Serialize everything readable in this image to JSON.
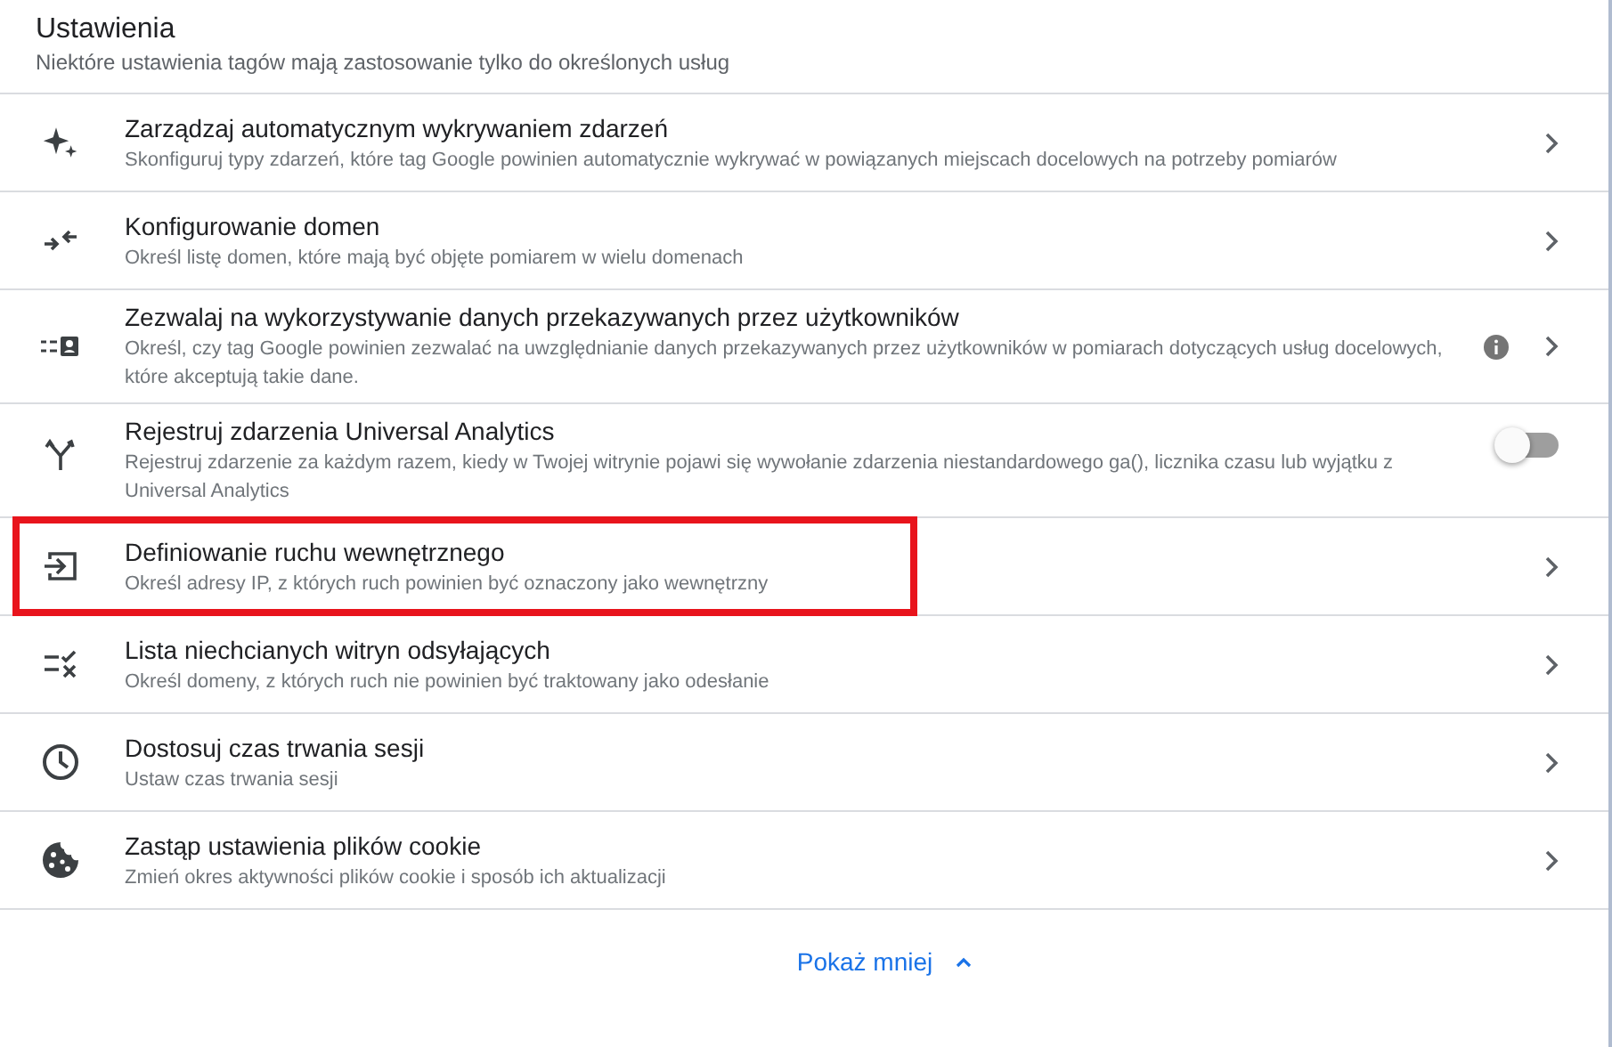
{
  "header": {
    "title": "Ustawienia",
    "subtitle": "Niektóre ustawienia tagów mają zastosowanie tylko do określonych usług"
  },
  "settings": [
    {
      "title": "Zarządzaj automatycznym wykrywaniem zdarzeń",
      "description": "Skonfiguruj typy zdarzeń, które tag Google powinien automatycznie wykrywać w powiązanych miejscach docelowych na potrzeby pomiarów",
      "kind": "link",
      "highlighted": false
    },
    {
      "title": "Konfigurowanie domen",
      "description": "Określ listę domen, które mają być objęte pomiarem w wielu domenach",
      "kind": "link",
      "highlighted": false
    },
    {
      "title": "Zezwalaj na wykorzystywanie danych przekazywanych przez użytkowników",
      "description": "Określ, czy tag Google powinien zezwalać na uwzględnianie danych przekazywanych przez użytkowników w pomiarach dotyczących usług docelowych, które akceptują takie dane.",
      "kind": "info_link",
      "highlighted": false
    },
    {
      "title": "Rejestruj zdarzenia Universal Analytics",
      "description": "Rejestruj zdarzenie za każdym razem, kiedy w Twojej witrynie pojawi się wywołanie zdarzenia niestandardowego ga(), licznika czasu lub wyjątku z Universal Analytics",
      "kind": "toggle",
      "on": false,
      "highlighted": false
    },
    {
      "title": "Definiowanie ruchu wewnętrznego",
      "description": "Określ adresy IP, z których ruch powinien być oznaczony jako wewnętrzny",
      "kind": "link",
      "highlighted": true
    },
    {
      "title": "Lista niechcianych witryn odsyłających",
      "description": "Określ domeny, z których ruch nie powinien być traktowany jako odesłanie",
      "kind": "link",
      "highlighted": false
    },
    {
      "title": "Dostosuj czas trwania sesji",
      "description": "Ustaw czas trwania sesji",
      "kind": "link",
      "highlighted": false
    },
    {
      "title": "Zastąp ustawienia plików cookie",
      "description": "Zmień okres aktywności plików cookie i sposób ich aktualizacji",
      "kind": "link",
      "highlighted": false
    }
  ],
  "footer": {
    "button": "Pokaż mniej"
  }
}
